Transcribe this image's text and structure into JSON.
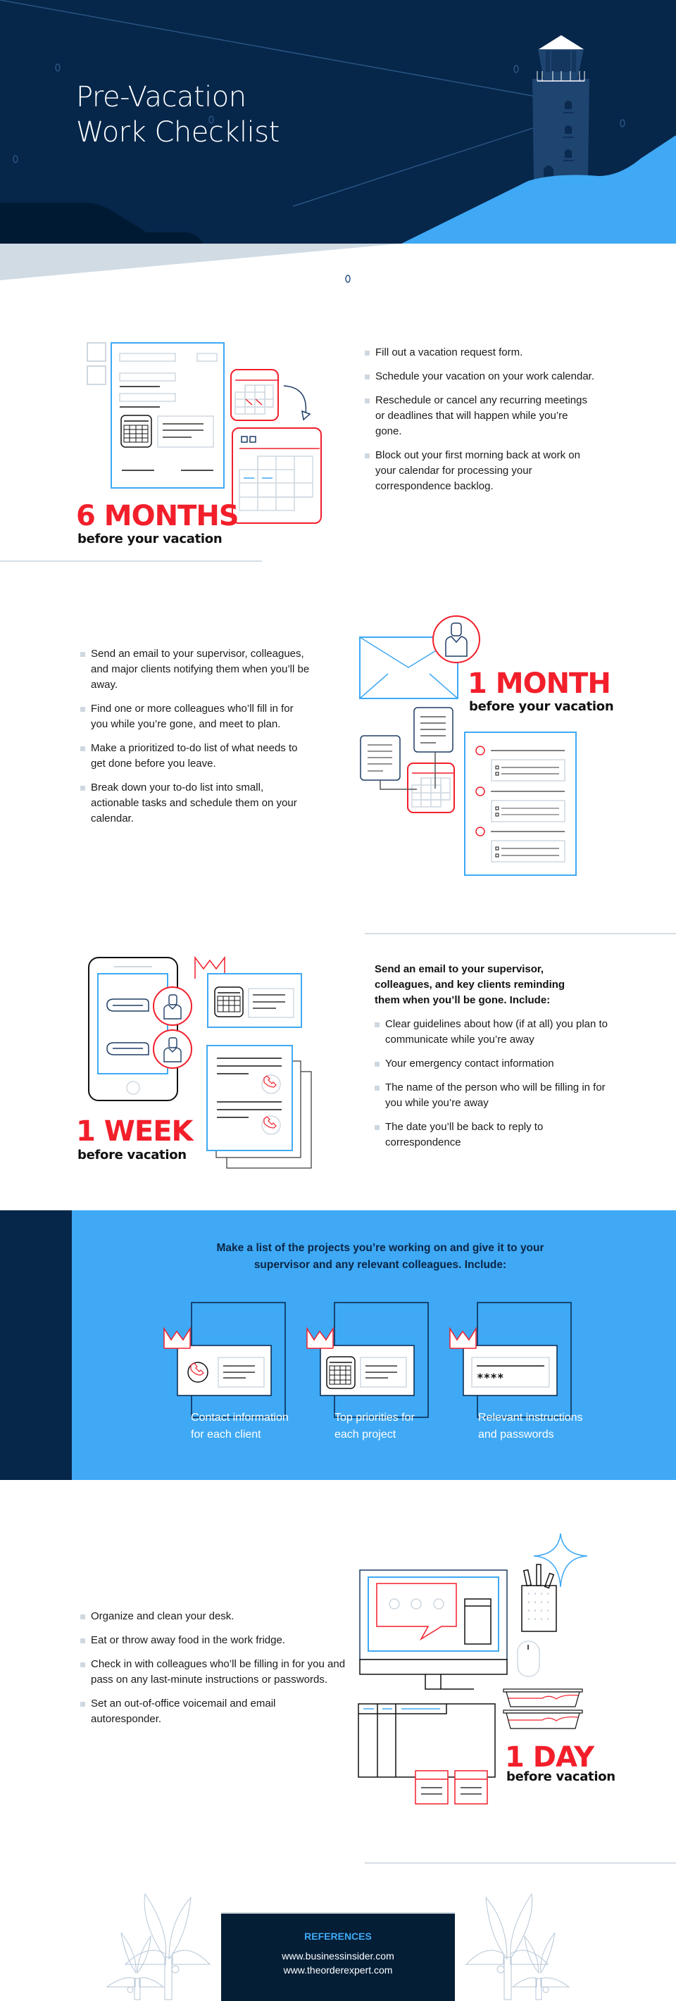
{
  "header": {
    "title_line1": "Pre-Vacation",
    "title_line2": "Work Checklist",
    "illustration": "lighthouse-icon"
  },
  "colors": {
    "navy": "#06264a",
    "dark_navy": "#001a33",
    "sky_blue": "#3fa9f5",
    "red": "#f21f2b",
    "light_gray": "#d5dee6"
  },
  "six_months": {
    "period": "6 MONTHS",
    "subtitle": "before your vacation",
    "items": [
      "Fill out a vacation request form.",
      "Schedule your vacation on your work calendar.",
      "Reschedule or cancel any recurring meetings or deadlines that will happen while you’re gone.",
      "Block out your first morning back at work on your calendar for processing your correspondence backlog."
    ]
  },
  "one_month": {
    "period": "1 MONTH",
    "subtitle": "before your vacation",
    "items": [
      "Send an email to your supervisor, colleagues, and major clients notifying them when you’ll be away.",
      "Find one or more colleagues who’ll fill in for you while you’re gone, and meet to plan.",
      "Make a prioritized to-do list of what needs to get done before you leave.",
      "Break down your to-do list into small, actionable tasks and schedule them on your calendar."
    ]
  },
  "one_week": {
    "period": "1 WEEK",
    "subtitle": "before vacation",
    "lead": "Send an email to your supervisor, colleagues, and key clients reminding them when you’ll be gone. Include:",
    "items": [
      "Clear guidelines about how (if at all) you plan to communicate while you’re away",
      "Your emergency contact information",
      "The name of the person who will be filling in for you while you’re away",
      "The date you’ll be back to reply to correspondence"
    ]
  },
  "projects": {
    "lead": "Make a list of the projects you’re working on and give it to your supervisor and any relevant colleagues. Include:",
    "cards": [
      {
        "icon": "phone-icon",
        "caption": "Contact information for each client"
      },
      {
        "icon": "calendar-icon",
        "caption": "Top priorities for each project"
      },
      {
        "icon": "password-icon",
        "caption": "Relevant instructions and passwords",
        "mask": "****"
      }
    ]
  },
  "one_day": {
    "period": "1 DAY",
    "subtitle": "before vacation",
    "items": [
      "Organize and clean your desk.",
      "Eat or throw away food in the work fridge.",
      "Check in with colleagues who’ll be filling in for you and pass on any last-minute instructions or passwords.",
      "Set an out-of-office voicemail and email autoresponder."
    ]
  },
  "references": {
    "title": "REFERENCES",
    "links": [
      "www.businessinsider.com",
      "www.theorderexpert.com"
    ]
  }
}
